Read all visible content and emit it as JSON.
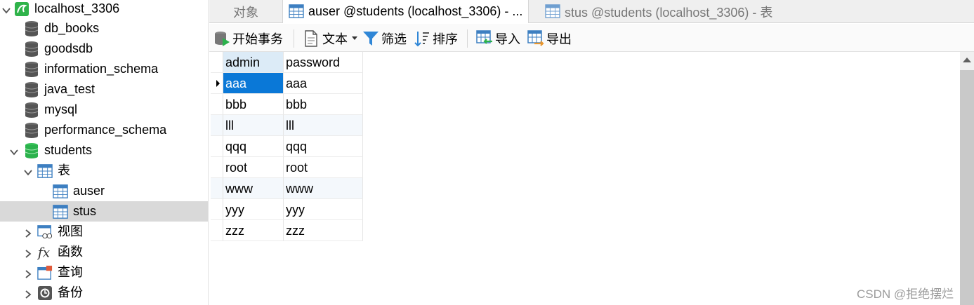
{
  "sidebar": {
    "connection": "localhost_3306",
    "databases": [
      "db_books",
      "goodsdb",
      "information_schema",
      "java_test",
      "mysql",
      "performance_schema"
    ],
    "active_db": "students",
    "tables_group": "表",
    "tables": [
      "auser",
      "stus"
    ],
    "selected_table": "stus",
    "groups": [
      "视图",
      "函数",
      "查询",
      "备份"
    ]
  },
  "tabs": [
    "对象",
    "auser @students (localhost_3306) - ...",
    "stus @students (localhost_3306) - 表"
  ],
  "toolbar": {
    "begin_transaction": "开始事务",
    "text": "文本",
    "filter": "筛选",
    "sort": "排序",
    "import": "导入",
    "export": "导出"
  },
  "grid": {
    "columns": [
      "admin",
      "password"
    ],
    "rows": [
      [
        "aaa",
        "aaa"
      ],
      [
        "bbb",
        "bbb"
      ],
      [
        "lll",
        "lll"
      ],
      [
        "qqq",
        "qqq"
      ],
      [
        "root",
        "root"
      ],
      [
        "www",
        "www"
      ],
      [
        "yyy",
        "yyy"
      ],
      [
        "zzz",
        "zzz"
      ]
    ]
  },
  "watermark": "CSDN @拒绝摆烂",
  "colors": {
    "accent": "#0a78d7",
    "selected_row": "#d9d9d9",
    "header_highlight": "#dcebf7",
    "active_db_icon": "#2bb24c",
    "db_icon": "#555555"
  }
}
